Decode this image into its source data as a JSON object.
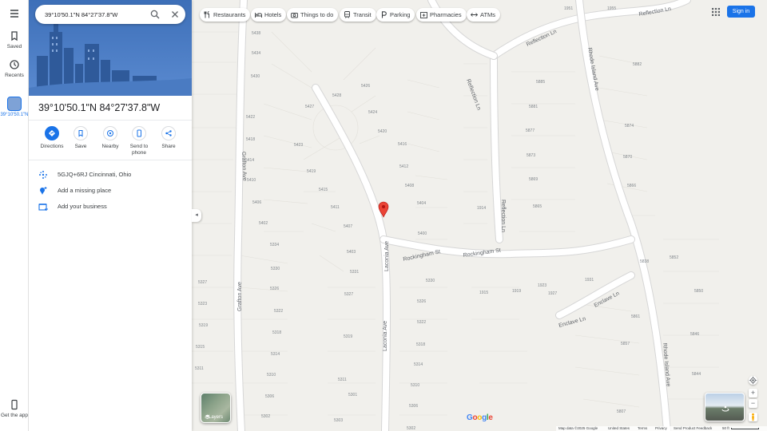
{
  "search": {
    "value": "39°10'50.1\"N 84°27'37.8\"W"
  },
  "rail": {
    "saved": "Saved",
    "recents": "Recents",
    "recent_place": "39°10'50.1\"N",
    "get_app": "Get the app"
  },
  "panel": {
    "title": "39°10'50.1\"N 84°27'37.8\"W",
    "actions": [
      {
        "label": "Directions"
      },
      {
        "label": "Save"
      },
      {
        "label": "Nearby"
      },
      {
        "label": "Send to phone"
      },
      {
        "label": "Share"
      }
    ],
    "plus_code": "5GJQ+6RJ Cincinnati, Ohio",
    "add_place": "Add a missing place",
    "add_business": "Add your business"
  },
  "chips": [
    {
      "label": "Restaurants",
      "icon": "fork-knife-icon"
    },
    {
      "label": "Hotels",
      "icon": "bed-icon"
    },
    {
      "label": "Things to do",
      "icon": "camera-icon"
    },
    {
      "label": "Transit",
      "icon": "train-icon"
    },
    {
      "label": "Parking",
      "icon": "parking-icon"
    },
    {
      "label": "Pharmacies",
      "icon": "pharmacy-icon"
    },
    {
      "label": "ATMs",
      "icon": "atm-icon"
    }
  ],
  "header": {
    "sign_in": "Sign in"
  },
  "map": {
    "streets": {
      "reflection_ln_top": "Reflection Ln",
      "reflection_ln_top2": "Reflection Ln",
      "reflection_ln_vert": "Reflection Ln",
      "reflection_ln_mid": "Reflection Ln",
      "rhode_island_ave": "Rhode Island Ave",
      "rhode_island_ave_lower": "Rhode Island Ave",
      "grafton_ave": "Grafton Ave",
      "grafton_ave_lower": "Grafton Ave",
      "rockingham_st": "Rockingham St",
      "rockingham_st_2": "Rockingham St",
      "laconia_ave": "Laconia Ave",
      "laconia_ave_lower": "Laconia Ave",
      "enclave_ln": "Enclave Ln",
      "enclave_ln_2": "Enclave Ln"
    },
    "house_numbers": {
      "n5438": "5438",
      "n5434": "5434",
      "n5430": "5430",
      "n5426": "5426",
      "n5427": "5427",
      "n5428": "5428",
      "n5424": "5424",
      "n5422": "5422",
      "n5420": "5420",
      "n5423": "5423",
      "n5418": "5418",
      "n5416": "5416",
      "n5419": "5419",
      "n5414": "5414",
      "n5412": "5412",
      "n5410": "5410",
      "n5415": "5415",
      "n5408": "5408",
      "n5406": "5406",
      "n5411": "5411",
      "n5404": "5404",
      "n5402": "5402",
      "n5407": "5407",
      "n5400": "5400",
      "n5334": "5334",
      "n5403": "5403",
      "n5330": "5330",
      "n5331": "5331",
      "n5327": "5327",
      "n5326": "5326",
      "n5327b": "5327",
      "n5323": "5323",
      "n5322": "5322",
      "n5319": "5319",
      "n5318": "5318",
      "n5319b": "5319",
      "n5315": "5315",
      "n5314": "5314",
      "n5311": "5311",
      "n5310": "5310",
      "n5311b": "5311",
      "n5306": "5306",
      "n5301": "5301",
      "n5302": "5302",
      "n5303": "5303",
      "n5330b": "5330",
      "n5326b": "5326",
      "n5322b": "5322",
      "n5318b": "5318",
      "n5314b": "5314",
      "n5310b": "5310",
      "n5306b": "5306",
      "n5302b": "5302",
      "n5882": "5882",
      "n5885": "5885",
      "n5881": "5881",
      "n5877": "5877",
      "n5874": "5874",
      "n5873": "5873",
      "n5870": "5870",
      "n5869": "5869",
      "n5866": "5866",
      "n5865": "5865",
      "n5838": "5838",
      "n5852": "5852",
      "n5850": "5850",
      "n5861": "5861",
      "n5846": "5846",
      "n5857": "5857",
      "n5844": "5844",
      "n5807": "5807",
      "n1914": "1914",
      "n1915": "1915",
      "n1919": "1919",
      "n1923": "1923",
      "n1927": "1927",
      "n1931": "1931",
      "n1951": "1951",
      "n1955": "1955"
    }
  },
  "controls": {
    "layers": "Layers"
  },
  "logo": {
    "text": "Google"
  },
  "footer": {
    "map_data": "Map data ©2025 Google",
    "country": "United States",
    "terms": "Terms",
    "privacy": "Privacy",
    "feedback": "Send Product Feedback",
    "scale": "50 ft"
  },
  "colors": {
    "accent": "#1a73e8",
    "pin": "#ea4335",
    "road": "#ffffff",
    "road_edge": "#d6d6d6",
    "map_bg": "#f1f0ec"
  }
}
